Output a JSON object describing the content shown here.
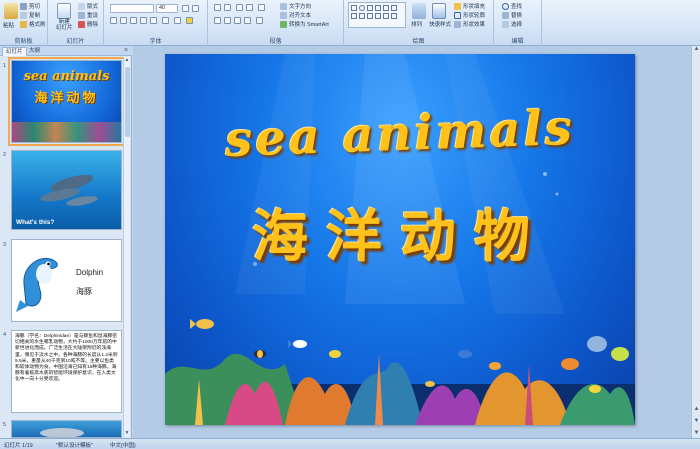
{
  "ribbon": {
    "clipboard": {
      "paste": "粘贴",
      "cut": "剪切",
      "copy": "复制",
      "format_painter": "格式刷",
      "label": "剪贴板"
    },
    "slides": {
      "new_slide": "新建",
      "new_slide_sub": "幻灯片",
      "layout": "版式",
      "reset": "重设",
      "delete": "删除",
      "label": "幻灯片"
    },
    "font": {
      "size": "40",
      "label": "字体"
    },
    "paragraph": {
      "text_direction": "文字方向",
      "align_text": "对齐文本",
      "smartart": "转换为 SmartArt",
      "label": "段落"
    },
    "drawing": {
      "arrange": "排列",
      "quick_styles": "快速样式",
      "fill": "形状填充",
      "outline": "形状轮廓",
      "effects": "形状效果",
      "label": "绘图"
    },
    "editing": {
      "find": "查找",
      "replace": "替换",
      "select": "选择",
      "label": "编辑"
    }
  },
  "panel": {
    "tabs": [
      "幻灯片",
      "大纲"
    ],
    "slides": [
      {
        "num": "1",
        "title_en": "sea animals",
        "title_cn": "海洋动物"
      },
      {
        "num": "2",
        "caption": "What's this?"
      },
      {
        "num": "3",
        "name_en": "Dolphin",
        "name_cn": "海豚"
      },
      {
        "num": "4",
        "text": "海豚（学名：Delphinidae）是与鲸鱼和鼠海豚密切相关的水生哺乳动物，大约于1000万年前的中新世进化而成。广泛生活在大陆架附近的浅海里，偶见于淡水之中。各种海豚的长度从1.2米到9.5米，重量从40千克到10吨不等。主要以鱼类和软体动物为食。中国沿海已知有15种海豚。海豚有着极高水底的智能环境保护意识，在人类文化中一向十分受欢迎。"
      },
      {
        "num": "5"
      }
    ]
  },
  "slide": {
    "title_en": "sea animals",
    "title_cn": "海洋动物"
  },
  "status": {
    "slide_of": "幻灯片 1/19",
    "theme": "\"默认设计模板\"",
    "language": "中文(中国)"
  }
}
